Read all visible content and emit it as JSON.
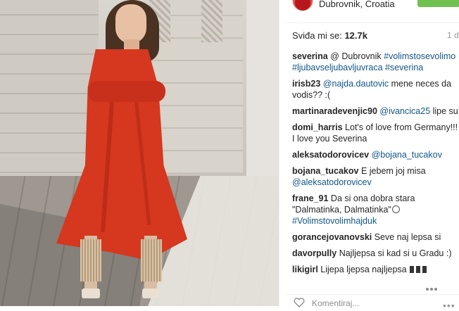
{
  "header": {
    "location": "Dubrovnik, Croatia"
  },
  "stats": {
    "likes_label": "Sviđa mi se:",
    "likes_count": "12.7k",
    "time": "1 d"
  },
  "comments": [
    {
      "user": "severina",
      "parts": [
        {
          "t": "text",
          "v": " @ Dubrovnik "
        },
        {
          "t": "tag",
          "v": "#volimstosevolimo"
        },
        {
          "t": "text",
          "v": " "
        },
        {
          "t": "tag",
          "v": "#ljubavseljubavljuvraca"
        },
        {
          "t": "text",
          "v": " "
        },
        {
          "t": "tag",
          "v": "#severina"
        }
      ]
    },
    {
      "user": "irisb23",
      "parts": [
        {
          "t": "text",
          "v": " "
        },
        {
          "t": "tag",
          "v": "@najda.dautovic"
        },
        {
          "t": "text",
          "v": " mene neces da vodis?? :("
        }
      ]
    },
    {
      "user": "martinaradevenjic90",
      "parts": [
        {
          "t": "text",
          "v": " "
        },
        {
          "t": "tag",
          "v": "@ivancica25"
        },
        {
          "t": "text",
          "v": " lipe su"
        }
      ]
    },
    {
      "user": "domi_harris",
      "parts": [
        {
          "t": "text",
          "v": " Lot's of love from Germany!!! I love you Severina"
        }
      ]
    },
    {
      "user": "aleksatodorovicev",
      "parts": [
        {
          "t": "text",
          "v": " "
        },
        {
          "t": "tag",
          "v": "@bojana_tucakov"
        }
      ]
    },
    {
      "user": "bojana_tucakov",
      "parts": [
        {
          "t": "text",
          "v": " E jebem joj misa "
        },
        {
          "t": "tag",
          "v": "@aleksatodorovicev"
        }
      ]
    },
    {
      "user": "frane_91",
      "parts": [
        {
          "t": "text",
          "v": " Da si ona dobra stara \"Dalmatinka, Dalmatinka\""
        },
        {
          "t": "emoji",
          "v": "smile-emoji"
        },
        {
          "t": "text",
          "v": " "
        },
        {
          "t": "tag",
          "v": "#Volimstovolimhajduk"
        }
      ]
    },
    {
      "user": "gorancejovanovski",
      "parts": [
        {
          "t": "text",
          "v": " Seve naj lepsa si"
        }
      ]
    },
    {
      "user": "davorpully",
      "parts": [
        {
          "t": "text",
          "v": " Najljepsa si kad si u Gradu :)"
        }
      ]
    },
    {
      "user": "likigirl",
      "parts": [
        {
          "t": "text",
          "v": " Lijepa ljepsa najljepsa "
        },
        {
          "t": "emoji",
          "v": "fire-emoji"
        }
      ]
    }
  ],
  "footer": {
    "comment_placeholder": "Komentiraj..."
  },
  "icons": {
    "heart": "heart-icon",
    "more": "more-icon"
  },
  "colors": {
    "follow_button": "#70c050",
    "link": "#125688",
    "dress": "#d6371f"
  }
}
